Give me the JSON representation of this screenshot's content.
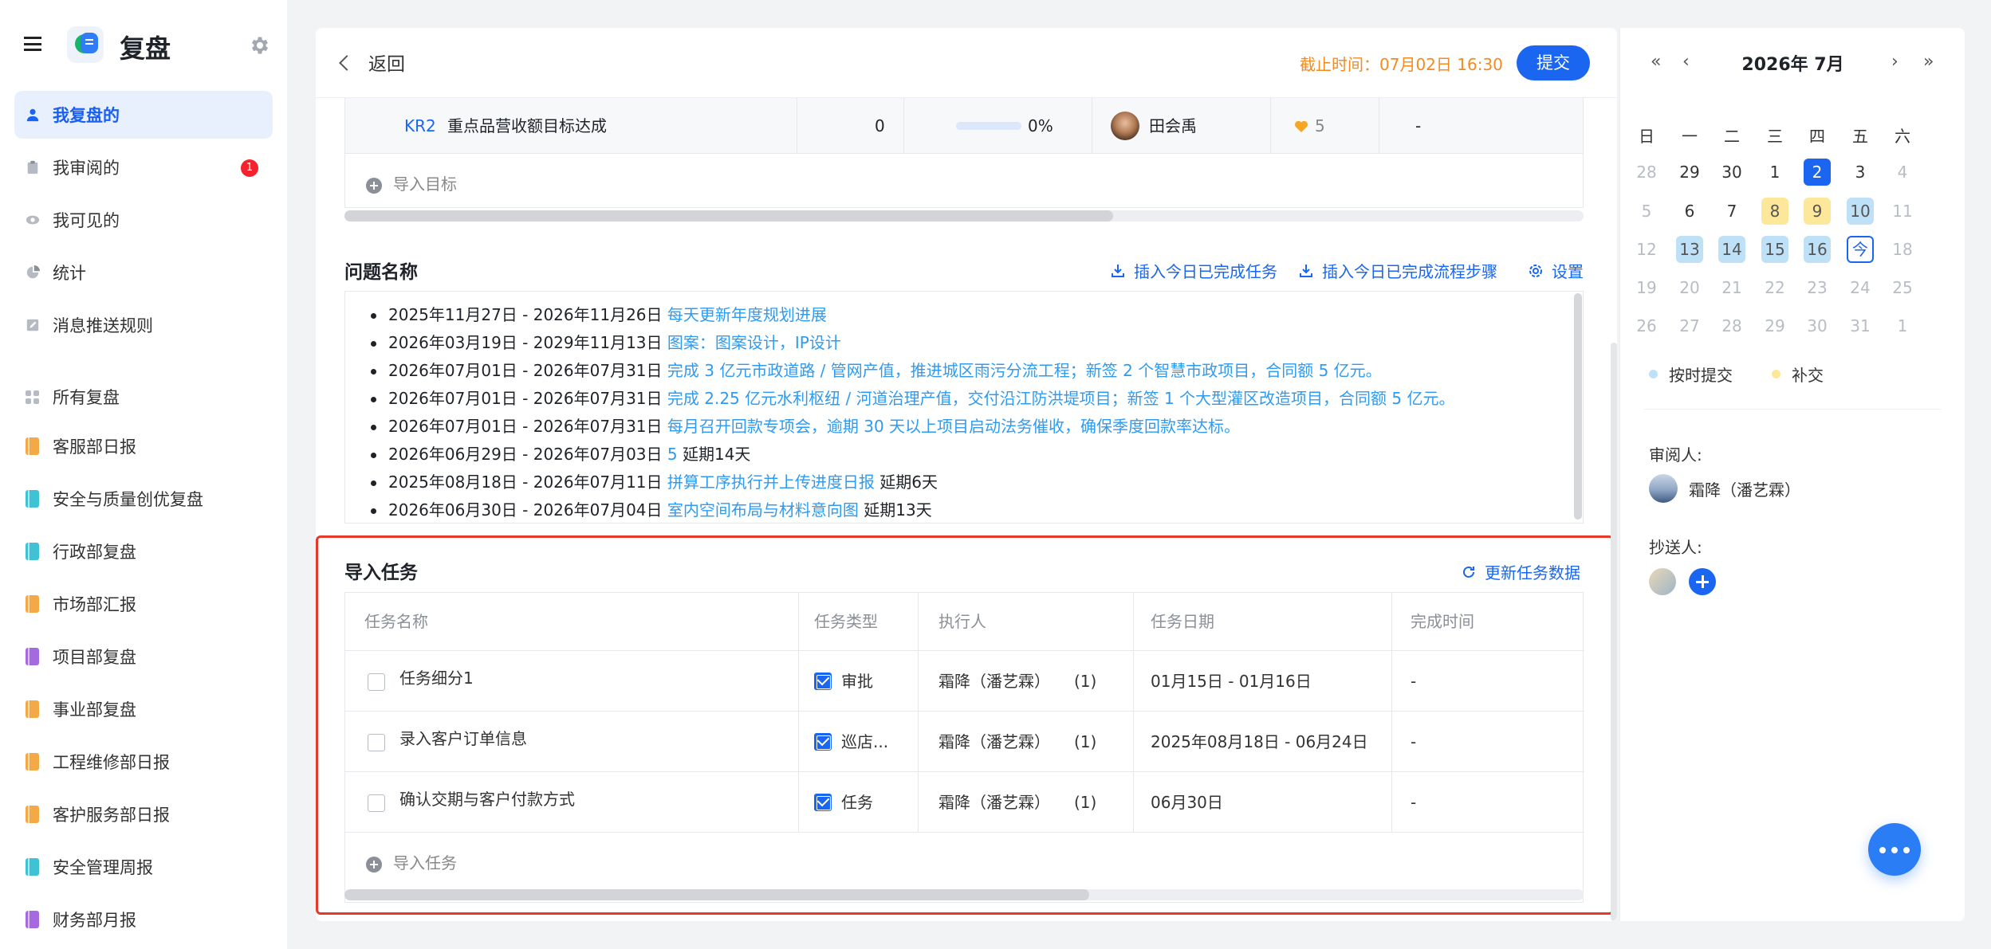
{
  "app": {
    "name": "复盘"
  },
  "sidebar": {
    "items": [
      {
        "label": "我复盘的",
        "active": true
      },
      {
        "label": "我审阅的",
        "badge": "1"
      },
      {
        "label": "我可见的"
      },
      {
        "label": "统计"
      },
      {
        "label": "消息推送规则"
      }
    ],
    "all_label": "所有复盘",
    "groups": [
      {
        "label": "客服部日报",
        "color": "#f4a947"
      },
      {
        "label": "安全与质量创优复盘",
        "color": "#3fc3d4"
      },
      {
        "label": "行政部复盘",
        "color": "#3fc3d4"
      },
      {
        "label": "市场部汇报",
        "color": "#f4a947"
      },
      {
        "label": "项目部复盘",
        "color": "#a66ae0"
      },
      {
        "label": "事业部复盘",
        "color": "#f4a947"
      },
      {
        "label": "工程维修部日报",
        "color": "#f4a947"
      },
      {
        "label": "客护服务部日报",
        "color": "#f4a947"
      },
      {
        "label": "安全管理周报",
        "color": "#3fc3d4"
      },
      {
        "label": "财务部月报",
        "color": "#a66ae0"
      }
    ]
  },
  "header": {
    "back_label": "返回",
    "deadline": "截止时间：07月02日 16:30",
    "submit_label": "提交"
  },
  "kr_row": {
    "code": "KR2",
    "name": "重点品营收额目标达成",
    "count": "0",
    "progress": "0%",
    "owner": "田会禹",
    "likes": "5",
    "extra": "-"
  },
  "import_goal_label": "导入目标",
  "issues": {
    "title": "问题名称",
    "actions": [
      "插入今日已完成任务",
      "插入今日已完成流程步骤",
      "设置"
    ],
    "items": [
      {
        "range": "2025年11月27日 - 2026年11月26日",
        "link": "每天更新年度规划进展",
        "tail": ""
      },
      {
        "range": "2026年03月19日 - 2029年11月13日",
        "link": "图案：图案设计，IP设计",
        "tail": ""
      },
      {
        "range": "2026年07月01日 - 2026年07月31日",
        "link": "完成 3 亿元市政道路 / 管网产值，推进城区雨污分流工程；新签 2 个智慧市政项目，合同额 5 亿元。",
        "tail": ""
      },
      {
        "range": "2026年07月01日 - 2026年07月31日",
        "link": "完成 2.25 亿元水利枢纽 / 河道治理产值，交付沿江防洪堤项目；新签 1 个大型灌区改造项目，合同额 5 亿元。",
        "tail": ""
      },
      {
        "range": "2026年07月01日 - 2026年07月31日",
        "link": "每月召开回款专项会，逾期 30 天以上项目启动法务催收，确保季度回款率达标。",
        "tail": ""
      },
      {
        "range": "2026年06月29日 - 2026年07月03日",
        "link": "5",
        "tail": "延期14天"
      },
      {
        "range": "2025年08月18日 - 2026年07月11日",
        "link": "拼算工序执行并上传进度日报",
        "tail": "延期6天"
      },
      {
        "range": "2026年06月30日 - 2026年07月04日",
        "link": "室内空间布局与材料意向图",
        "tail": "延期13天"
      }
    ]
  },
  "tasks": {
    "title": "导入任务",
    "refresh_label": "更新任务数据",
    "columns": [
      "任务名称",
      "任务类型",
      "执行人",
      "任务日期",
      "完成时间"
    ],
    "rows": [
      {
        "name": "任务细分1",
        "type": "审批",
        "assignee": "霜降（潘艺霖）",
        "count": "(1)",
        "date": "01月15日 - 01月16日",
        "done": "-"
      },
      {
        "name": "录入客户订单信息",
        "type": "巡店...",
        "assignee": "霜降（潘艺霖）",
        "count": "(1)",
        "date": "2025年08月18日 - 06月24日",
        "done": "-"
      },
      {
        "name": "确认交期与客户付款方式",
        "type": "任务",
        "assignee": "霜降（潘艺霖）",
        "count": "(1)",
        "date": "06月30日",
        "done": "-"
      }
    ],
    "import_label": "导入任务"
  },
  "calendar": {
    "title": "2026年 7月",
    "weekdays": [
      "日",
      "一",
      "二",
      "三",
      "四",
      "五",
      "六"
    ],
    "weeks": [
      [
        "28",
        "29",
        "30",
        "1",
        "2",
        "3",
        "4"
      ],
      [
        "5",
        "6",
        "7",
        "8",
        "9",
        "10",
        "11"
      ],
      [
        "12",
        "13",
        "14",
        "15",
        "16",
        "今",
        "18"
      ],
      [
        "19",
        "20",
        "21",
        "22",
        "23",
        "24",
        "25"
      ],
      [
        "26",
        "27",
        "28",
        "29",
        "30",
        "31",
        "1"
      ]
    ],
    "legend": [
      {
        "label": "按时提交",
        "color": "#bfe1f7"
      },
      {
        "label": "补交",
        "color": "#fce79a"
      }
    ],
    "reviewer_label": "审阅人:",
    "reviewer": "霜降（潘艺霖）",
    "cc_label": "抄送人:"
  }
}
